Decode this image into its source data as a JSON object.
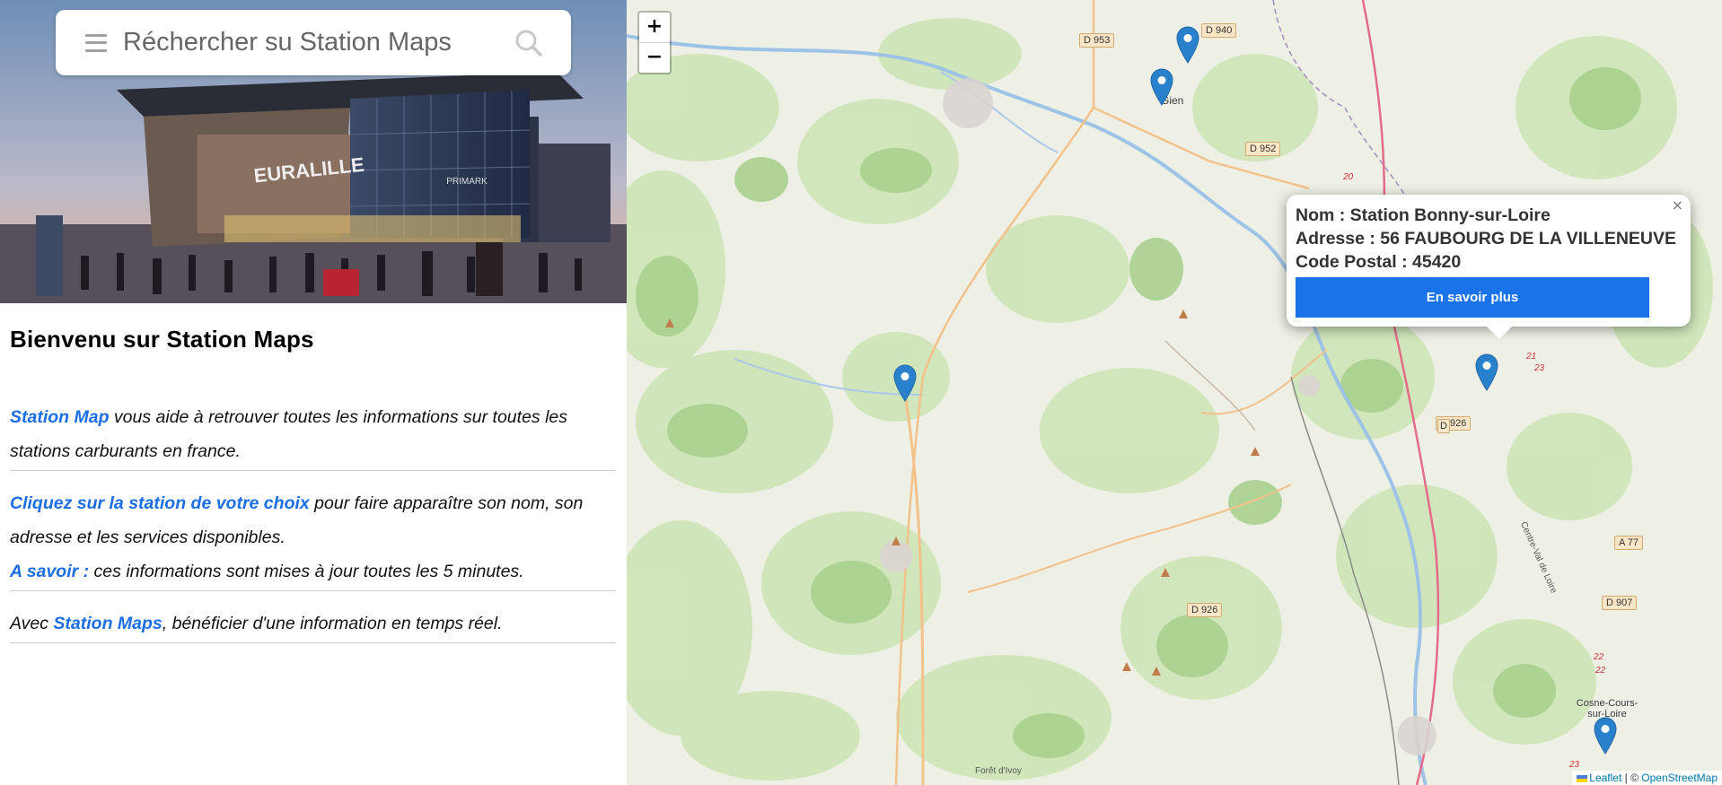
{
  "search": {
    "placeholder": "Réchercher su Station Maps"
  },
  "hero": {
    "sign_text": "EURALILLE",
    "store_text": "PRIMARK"
  },
  "intro": {
    "title": "Bienvenu sur Station Maps",
    "p1_highlight": "Station Map",
    "p1_rest": " vous aide à retrouver toutes les informations sur toutes les stations carburants en france.",
    "p2_highlight": "Cliquez sur la station de votre choix",
    "p2_rest": " pour faire apparaître son nom, son adresse et les services disponibles.",
    "p2b_highlight": "A savoir :",
    "p2b_rest": " ces informations sont mises à jour toutes les 5 minutes.",
    "p3_prefix": "Avec ",
    "p3_highlight": "Station Maps",
    "p3_rest": ", bénéficier d'une information en temps réel."
  },
  "map": {
    "zoom_in": "+",
    "zoom_out": "−",
    "popup": {
      "name_line": "Nom : Station Bonny-sur-Loire",
      "address_line": "Adresse : 56 FAUBOURG DE LA VILLENEUVE",
      "postal_line": "Code Postal : 45420",
      "button": "En savoir plus",
      "close": "×"
    },
    "labels": {
      "d953": "D 953",
      "d940": "D 940",
      "d952": "D 952",
      "d926a": "D 926",
      "d926b": "D 926",
      "a77": "A 77",
      "d907": "D 907",
      "gien": "Gien",
      "cosne": "Cosne-Cours-sur-Loire",
      "foret": "Forêt d'Ivoy",
      "loire": "Centre-Val de Loire",
      "n20": "20",
      "n21": "21",
      "n23a": "23",
      "n22a": "22",
      "n22b": "22",
      "n23b": "23",
      "d_small": "D"
    },
    "attribution": {
      "leaflet": "Leaflet",
      "sep": " | © ",
      "osm": "OpenStreetMap"
    }
  },
  "colors": {
    "accent": "#1c6ee4",
    "button": "#1a73e8",
    "marker": "#2a81cb"
  }
}
